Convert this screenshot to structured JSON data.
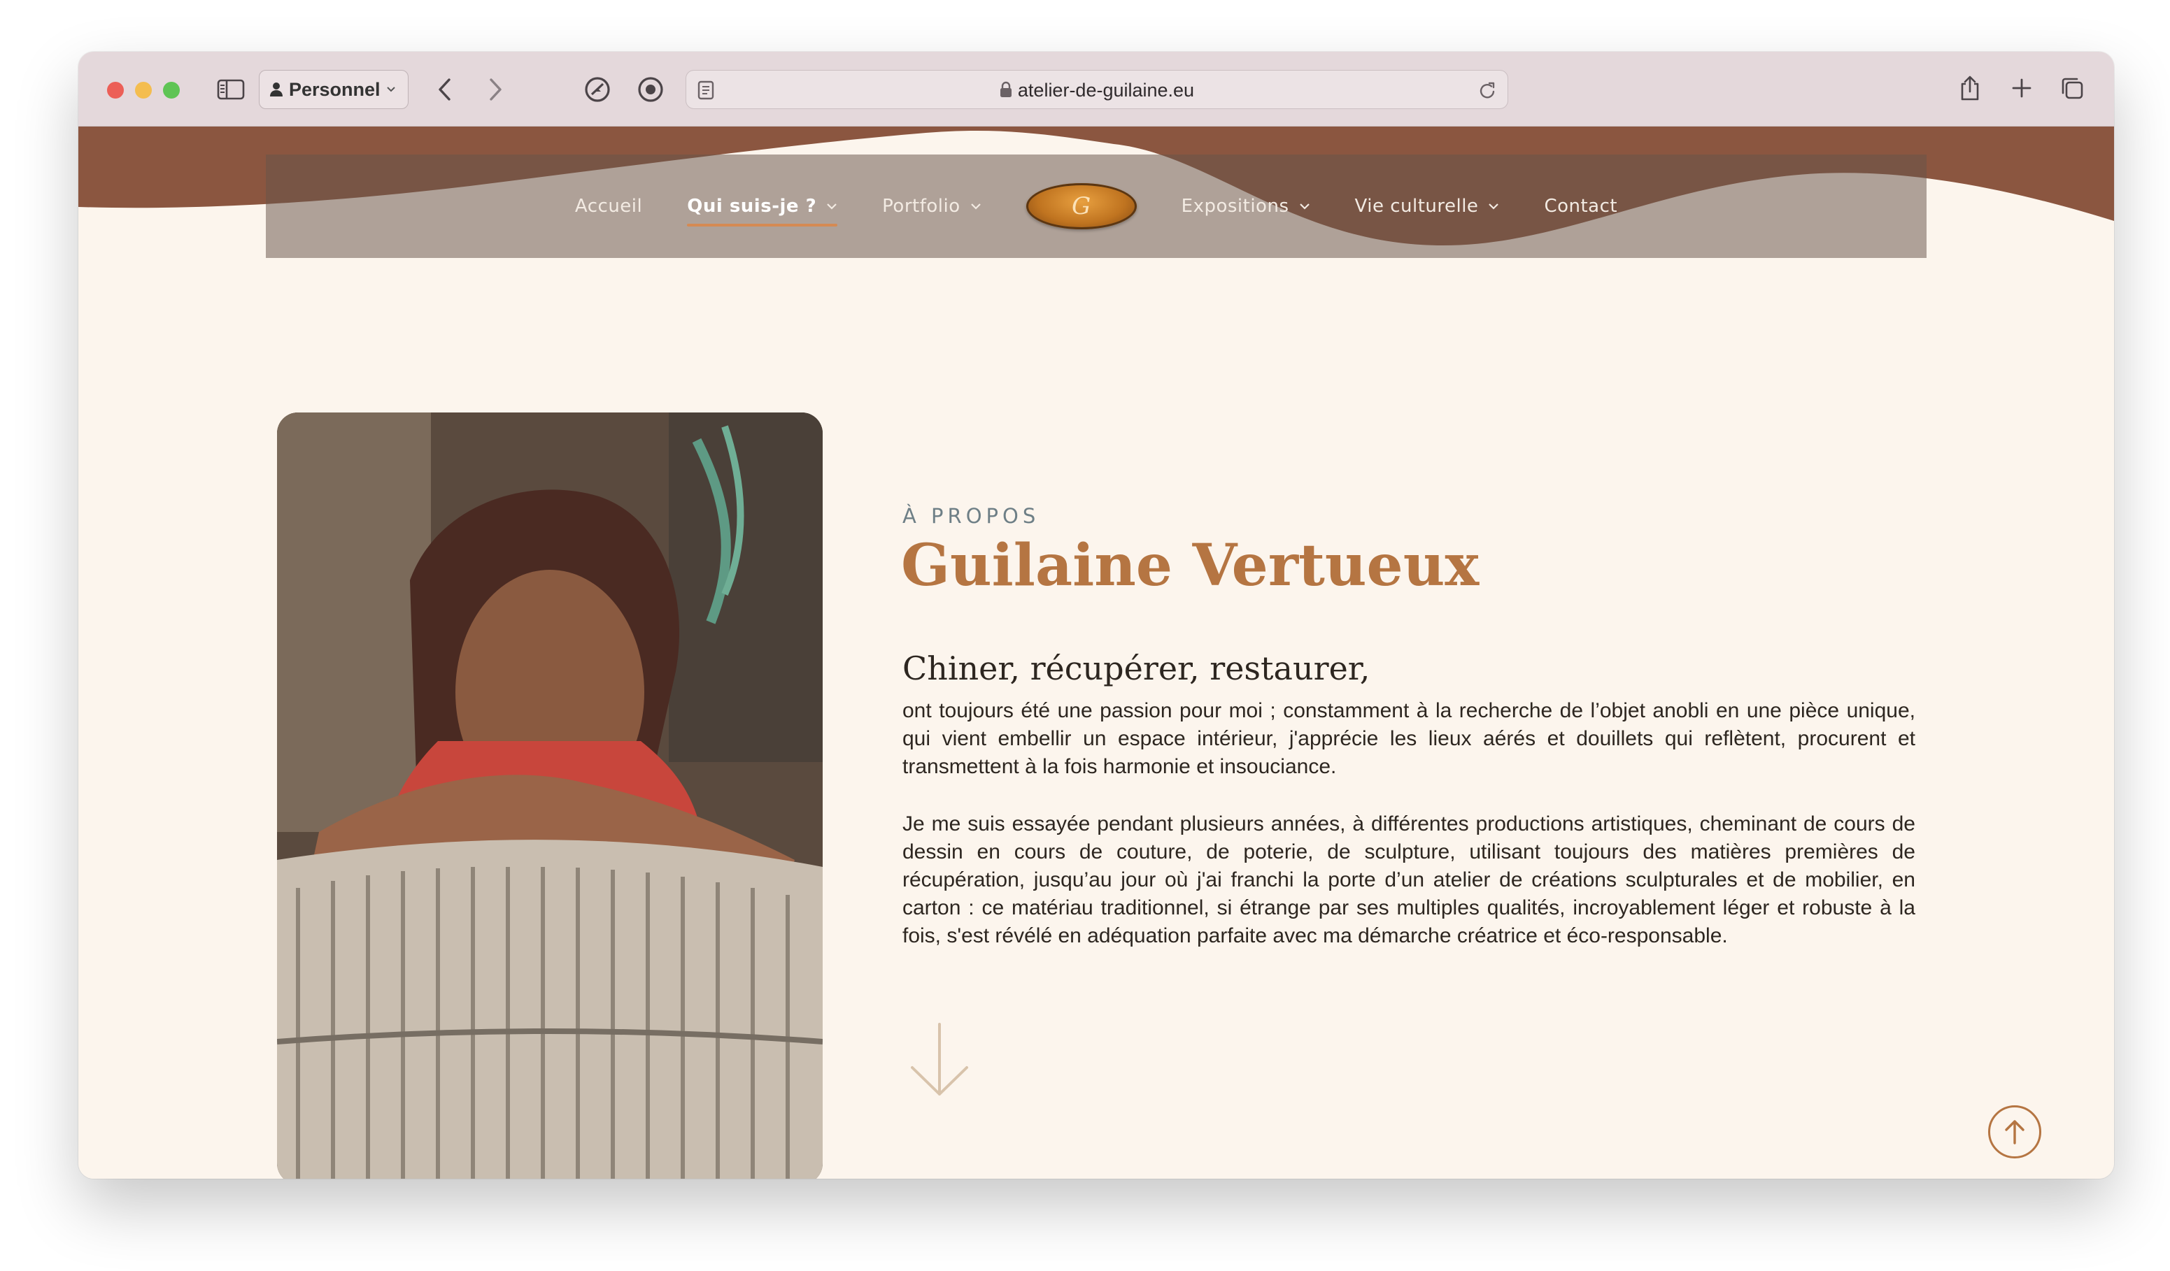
{
  "browser": {
    "profile_label": "Personnel",
    "url": "atelier-de-guilaine.eu"
  },
  "nav": {
    "items": [
      {
        "label": "Accueil",
        "dropdown": false
      },
      {
        "label": "Qui suis-je ?",
        "dropdown": true,
        "active": true
      },
      {
        "label": "Portfolio",
        "dropdown": true
      },
      {
        "label": "Expositions",
        "dropdown": true
      },
      {
        "label": "Vie culturelle",
        "dropdown": true
      },
      {
        "label": "Contact",
        "dropdown": false
      }
    ]
  },
  "about": {
    "eyebrow": "À PROPOS",
    "title": "Guilaine Vertueux",
    "subtitle": "Chiner, récupérer, restaurer,",
    "paragraph1": "ont toujours été une passion pour moi ; constamment à la recherche de l’objet anobli en une pièce unique, qui vient embellir un espace intérieur, j'apprécie les lieux aérés et douillets qui reflètent, procurent et transmettent à la fois harmonie et insouciance.",
    "paragraph2": "Je me suis essayée pendant plusieurs années, à différentes productions artistiques, cheminant de cours de dessin en cours de couture, de poterie, de sculpture, utilisant toujours des matières premières de récupération, jusqu’au jour où j'ai franchi la porte d’un atelier de créations sculpturales et de mobilier, en carton : ce matériau traditionnel, si étrange par ses multiples qualités, incroyablement léger et robuste à la fois, s'est révélé en adéquation parfaite avec ma démarche créatrice et éco-responsable."
  },
  "colors": {
    "brand_brown": "#8b5640",
    "accent_copper": "#b57542",
    "page_bg": "#fcf5ed"
  }
}
